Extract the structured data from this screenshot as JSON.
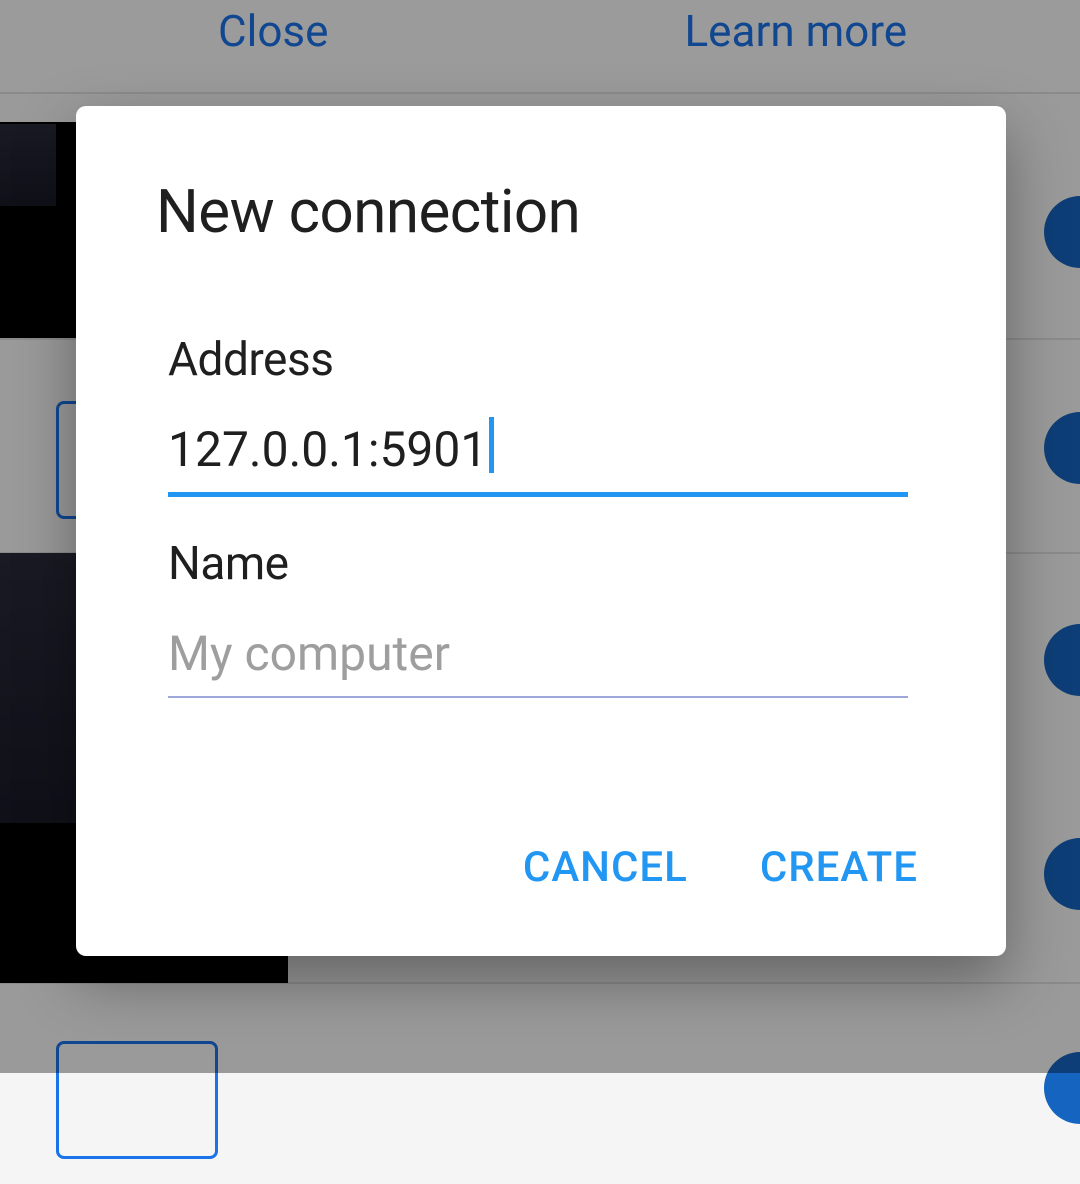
{
  "background": {
    "topbar": {
      "close_label": "Close",
      "learn_more_label": "Learn more"
    }
  },
  "dialog": {
    "title": "New connection",
    "fields": {
      "address": {
        "label": "Address",
        "value": "127.0.0.1:5901",
        "placeholder": ""
      },
      "name": {
        "label": "Name",
        "value": "",
        "placeholder": "My computer"
      }
    },
    "actions": {
      "cancel_label": "CANCEL",
      "create_label": "CREATE"
    }
  }
}
